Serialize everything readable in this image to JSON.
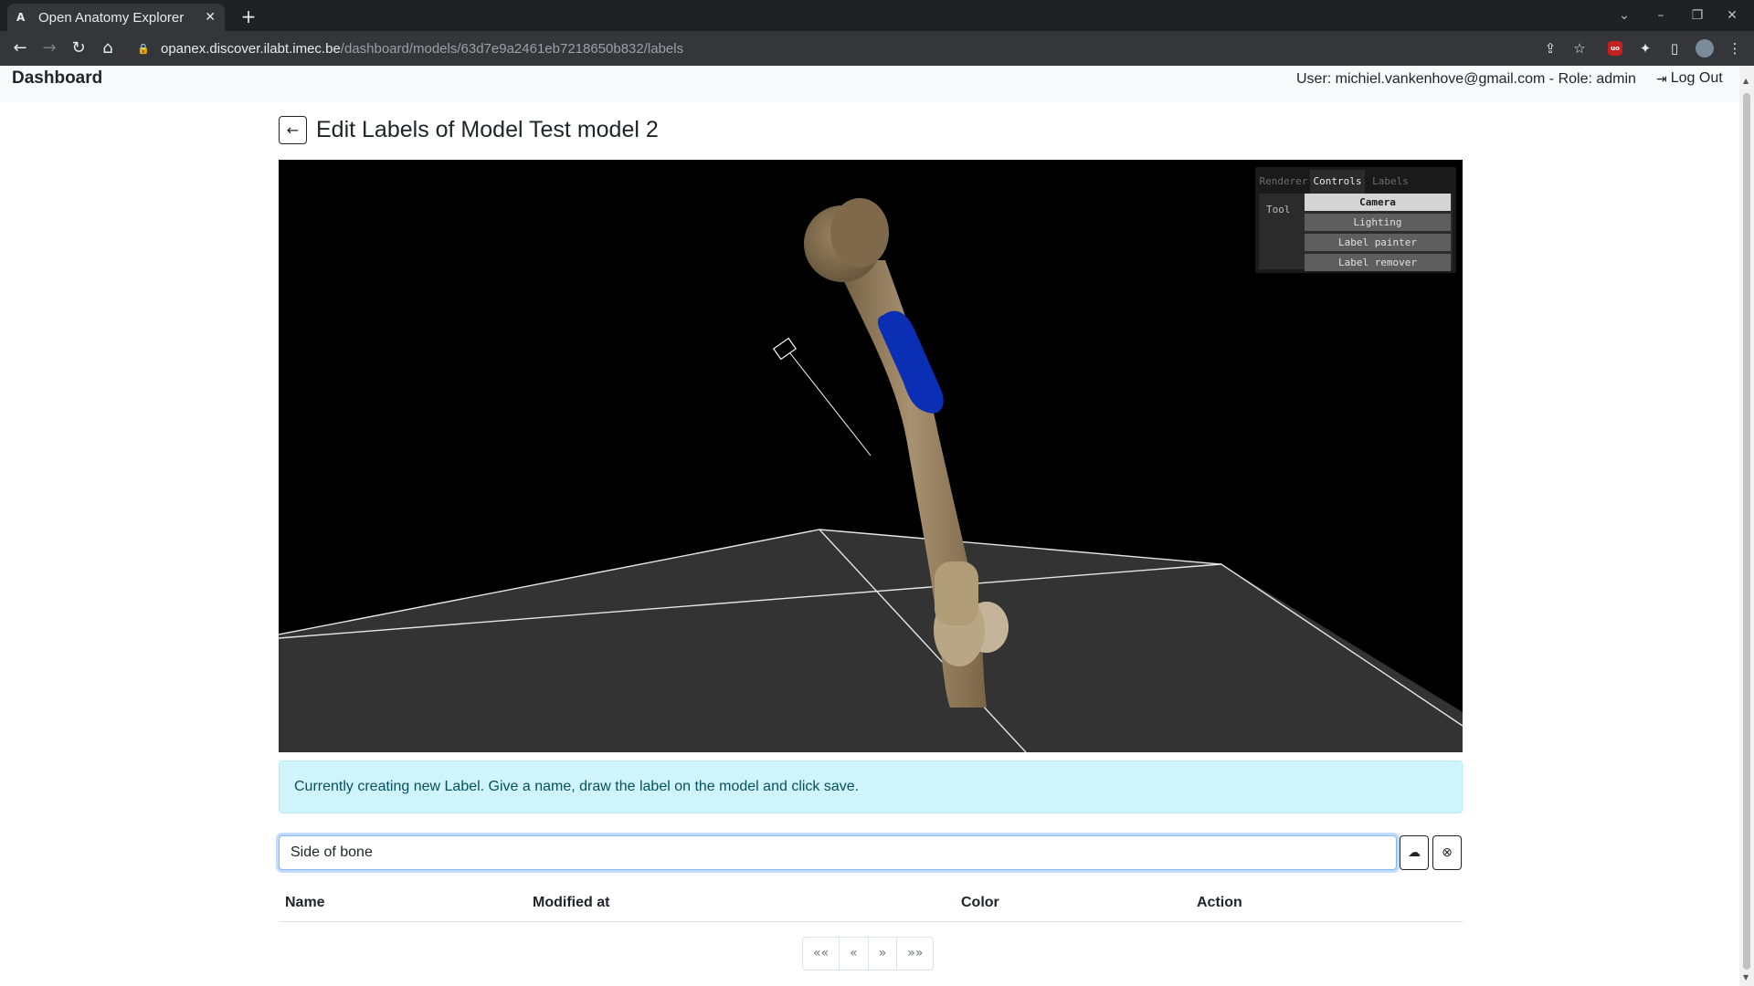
{
  "browser": {
    "tab_favicon": "A",
    "tab_title": "Open Anatomy Explorer",
    "tab_close": "✕",
    "new_tab": "+",
    "url_host": "opanex.discover.ilabt.imec.be",
    "url_path": "/dashboard/models/63d7e9a2461eb7218650b832/labels",
    "ext_badge": "uo"
  },
  "navbar": {
    "brand": "Dashboard",
    "user_info": "User: michiel.vankenhove@gmail.com - Role: admin",
    "logout_label": "Log Out"
  },
  "page": {
    "title": "Edit Labels of Model Test model 2",
    "back_icon": "←"
  },
  "viewer_gui": {
    "tabs": [
      "Renderer",
      "Controls",
      "Labels"
    ],
    "active_tab": "Controls",
    "tool_label": "Tool",
    "tools": [
      "Camera",
      "Lighting",
      "Label painter",
      "Label remover"
    ],
    "selected_tool": "Camera"
  },
  "alert": {
    "message": "Currently creating new Label. Give a name, draw the label on the model and click save."
  },
  "label_form": {
    "name_value": "Side of bone"
  },
  "table": {
    "headers": [
      "Name",
      "Modified at",
      "Color",
      "Action"
    ],
    "rows": []
  },
  "pagination": [
    "««",
    "«",
    "»",
    "»»"
  ],
  "colors": {
    "accent": "#0d6efd",
    "alert_bg": "#cff4fc",
    "alert_text": "#055160",
    "label_paint": "#0a2fb5",
    "bone": "#a08a62"
  }
}
